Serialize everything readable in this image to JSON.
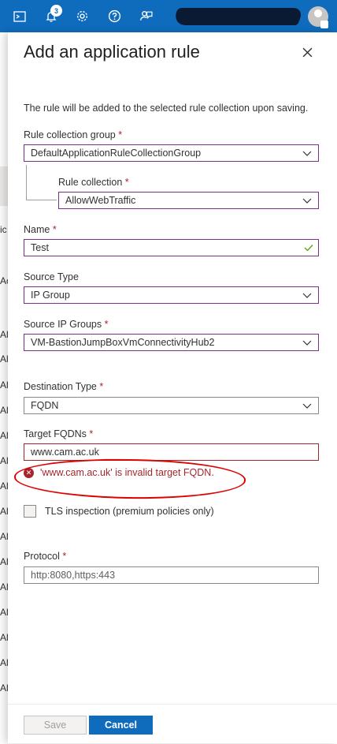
{
  "topbar": {
    "notification_count": "3",
    "icons": [
      "cloud-shell-icon",
      "notifications-icon",
      "settings-icon",
      "help-icon",
      "feedback-icon"
    ]
  },
  "background": {
    "letters": [
      "ic",
      "Ac",
      "All",
      "All",
      "All",
      "All",
      "All",
      "All",
      "All",
      "All",
      "All",
      "All",
      "All",
      "All",
      "All",
      "All",
      "All"
    ]
  },
  "panel": {
    "title": "Add an application rule",
    "description": "The rule will be added to the selected rule collection upon saving.",
    "rule_collection_group": {
      "label": "Rule collection group",
      "value": "DefaultApplicationRuleCollectionGroup"
    },
    "rule_collection": {
      "label": "Rule collection",
      "value": "AllowWebTraffic"
    },
    "name": {
      "label": "Name",
      "value": "Test"
    },
    "source_type": {
      "label": "Source Type",
      "value": "IP Group"
    },
    "source_ip_groups": {
      "label": "Source IP Groups",
      "value": "VM-BastionJumpBoxVmConnectivityHub2"
    },
    "destination_type": {
      "label": "Destination Type",
      "value": "FQDN"
    },
    "target_fqdns": {
      "label": "Target FQDNs",
      "value": "www.cam.ac.uk",
      "error": "'www.cam.ac.uk' is invalid target FQDN."
    },
    "tls_inspection": {
      "label": "TLS inspection (premium policies only)",
      "checked": false
    },
    "protocol": {
      "label": "Protocol",
      "placeholder": "http:8080,https:443"
    },
    "required_mark": "*",
    "save_label": "Save",
    "cancel_label": "Cancel"
  },
  "colors": {
    "accent": "#0f6cbd",
    "error": "#a4262c",
    "focus_border": "#7a2f8a"
  }
}
